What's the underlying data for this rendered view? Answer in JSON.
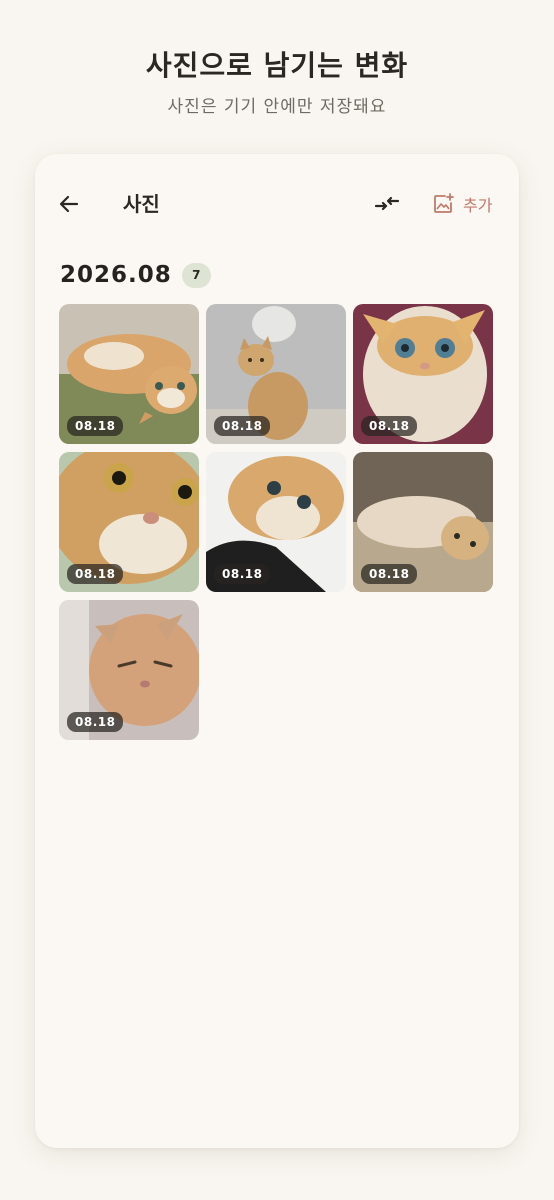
{
  "hero": {
    "title": "사진으로 남기는 변화",
    "subtitle": "사진은 기기 안에만 저장돼요"
  },
  "appbar": {
    "title": "사진",
    "add_label": "추가",
    "accent_color": "#c07a6a"
  },
  "group": {
    "date": "2026.08",
    "count": "7"
  },
  "photos": [
    {
      "date": "08.18",
      "description": "cat lying upside down on green cushion"
    },
    {
      "date": "08.18",
      "description": "cat sitting on floor near white wall"
    },
    {
      "date": "08.18",
      "description": "fluffy kitten face closeup"
    },
    {
      "date": "08.18",
      "description": "cat face extreme closeup"
    },
    {
      "date": "08.18",
      "description": "kitten on black and white fabric"
    },
    {
      "date": "08.18",
      "description": "cat lying on sofa"
    },
    {
      "date": "08.18",
      "description": "grumpy looking cat"
    }
  ]
}
